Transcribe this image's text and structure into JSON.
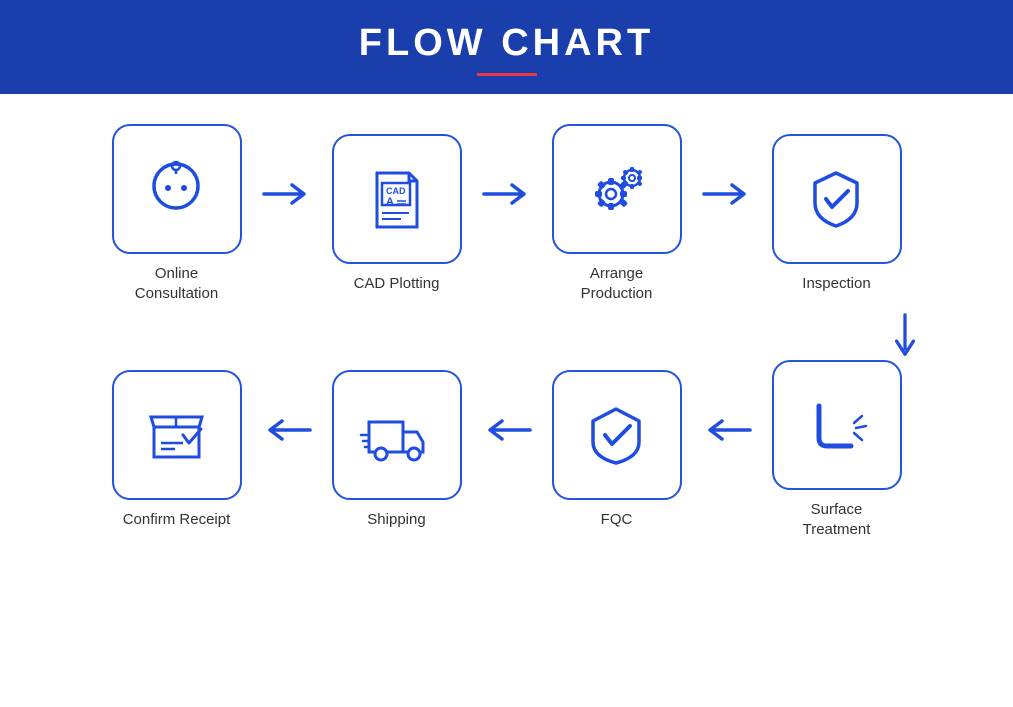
{
  "header": {
    "title": "FLOW CHART"
  },
  "steps": {
    "row1": [
      {
        "id": "online-consultation",
        "label": "Online\nConsultation"
      },
      {
        "id": "cad-plotting",
        "label": "CAD Plotting"
      },
      {
        "id": "arrange-production",
        "label": "Arrange\nProduction"
      },
      {
        "id": "inspection",
        "label": "Inspection"
      }
    ],
    "row2": [
      {
        "id": "confirm-receipt",
        "label": "Confirm Receipt"
      },
      {
        "id": "shipping",
        "label": "Shipping"
      },
      {
        "id": "fqc",
        "label": "FQC"
      },
      {
        "id": "surface-treatment",
        "label": "Surface\nTreatment"
      }
    ]
  },
  "colors": {
    "blue": "#1e4de0",
    "arrow": "#1e4de0"
  }
}
